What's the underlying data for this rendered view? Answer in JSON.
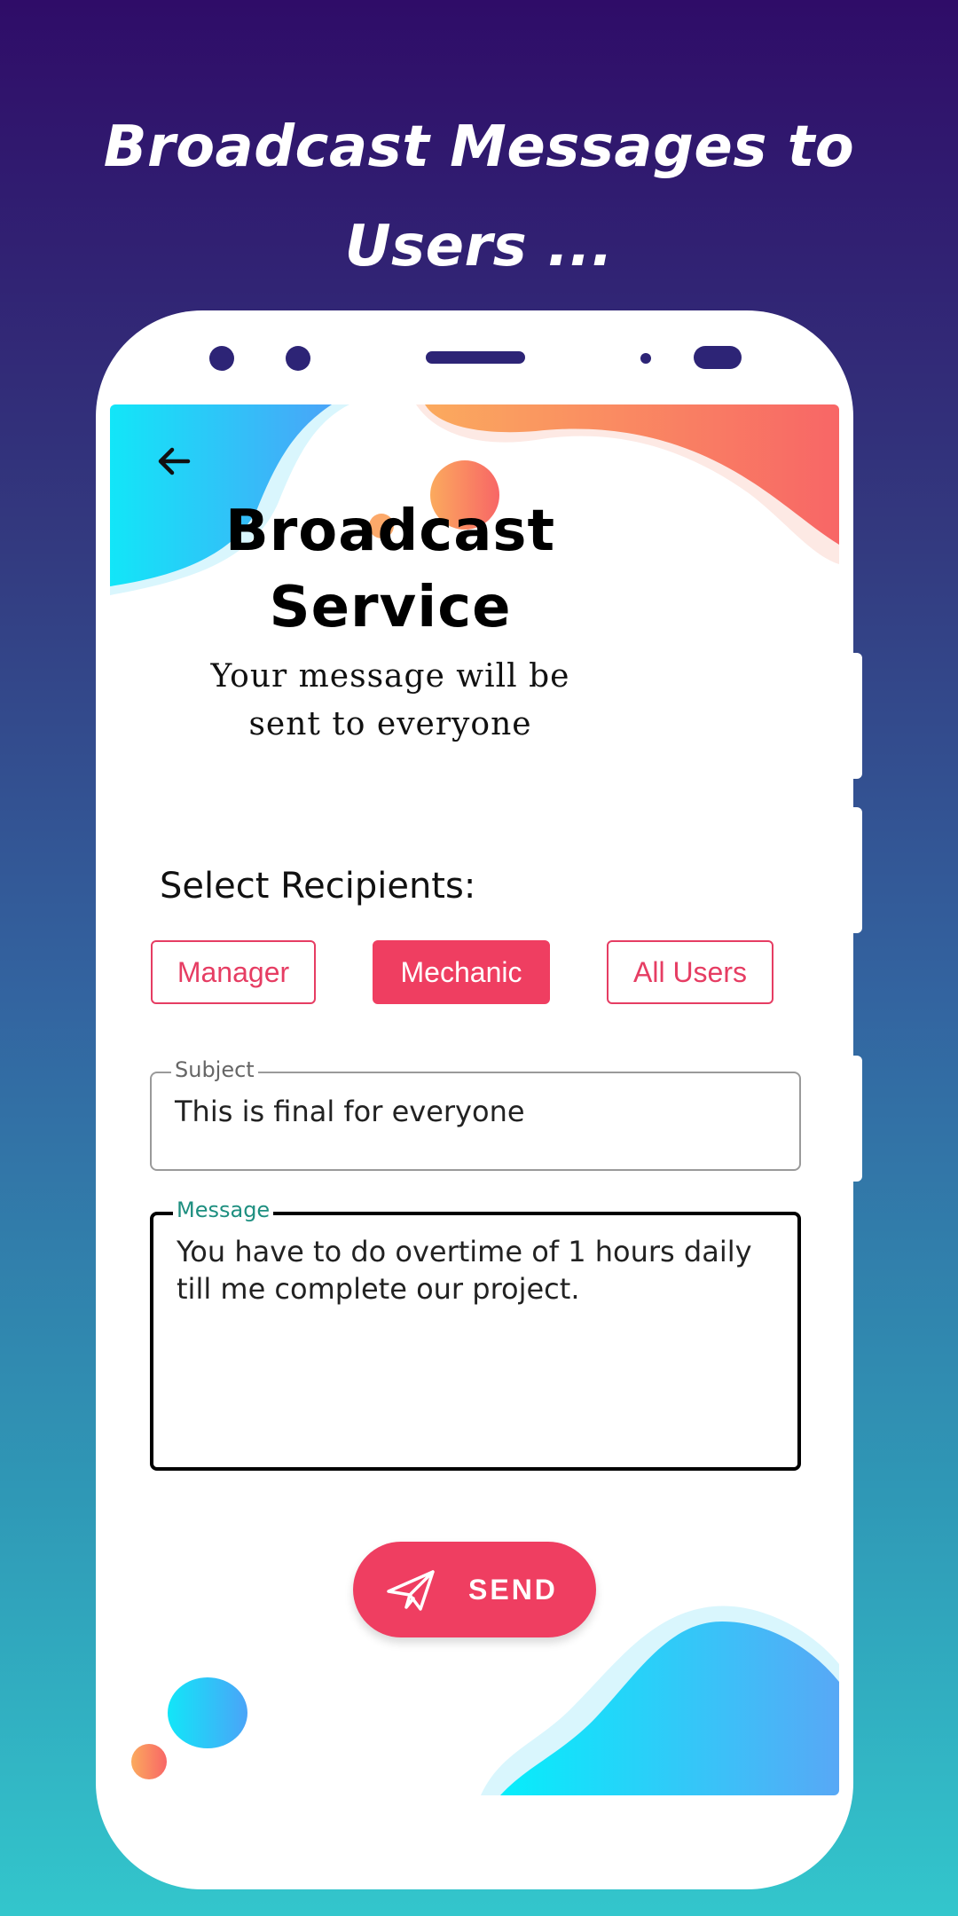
{
  "banner": {
    "title_line1": "Broadcast Messages to",
    "title_line2": "Users ..."
  },
  "screen": {
    "title_line1": "Broadcast",
    "title_line2": "Service",
    "subtitle_line1": "Your message will be",
    "subtitle_line2": "sent to everyone",
    "back_icon": "arrow-left-icon",
    "recipients": {
      "label": "Select Recipients:",
      "options": [
        {
          "label": "Manager",
          "selected": false
        },
        {
          "label": "Mechanic",
          "selected": true
        },
        {
          "label": "All Users",
          "selected": false
        }
      ]
    },
    "subject": {
      "label": "Subject",
      "value": "This is final for everyone"
    },
    "message": {
      "label": "Message",
      "value": "You have to do overtime of 1 hours daily\ntill me complete our project."
    },
    "send": {
      "label": "SEND",
      "icon": "paper-plane-icon"
    }
  },
  "colors": {
    "accent": "#ef3e61",
    "phone_frame": "#2d2476",
    "label_focus": "#1e8f80"
  }
}
